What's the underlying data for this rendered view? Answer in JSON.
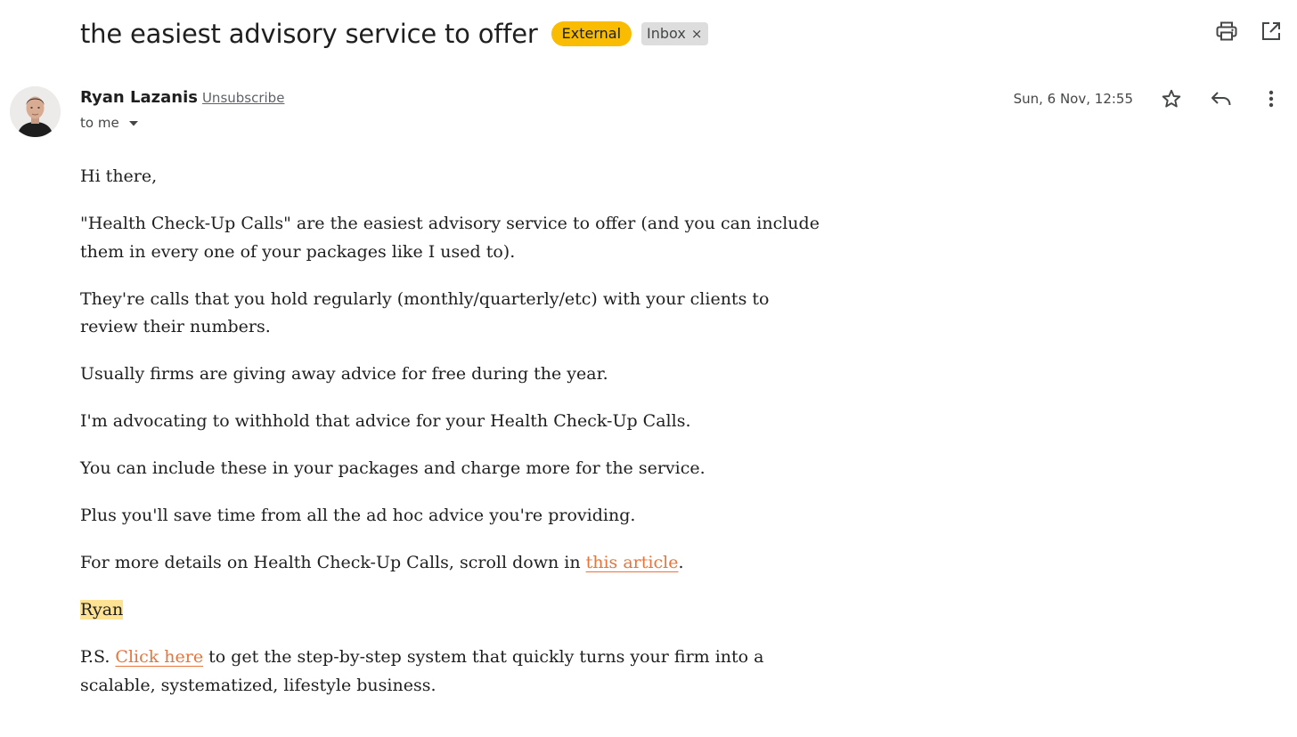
{
  "email": {
    "subject": "the easiest advisory service to offer",
    "labels": {
      "external": "External",
      "inbox": "Inbox",
      "remove_symbol": "×"
    },
    "sender": {
      "name": "Ryan Lazanis",
      "unsubscribe": "Unsubscribe",
      "recipient": "to me"
    },
    "date": "Sun, 6 Nov, 12:55",
    "body": {
      "p1": "Hi there,",
      "p2": "\"Health Check-Up Calls\" are the easiest advisory service to offer (and you can include them in every one of your packages like I used to).",
      "p3": "They're calls that you hold regularly (monthly/quarterly/etc) with your clients to review their numbers.",
      "p4": "Usually firms are giving away advice for free during the year.",
      "p5": "I'm advocating to withhold that advice for your Health Check-Up Calls.",
      "p6": "You can include these in your packages and charge more for the service.",
      "p7": "Plus you'll save time from all the ad hoc advice you're providing.",
      "p8_before": "For more details on Health Check-Up Calls, scroll down in ",
      "p8_link": "this article",
      "p8_after": ".",
      "signature": "Ryan",
      "ps_before": "P.S. ",
      "ps_link": "Click here",
      "ps_after": " to get the step-by-step system that quickly turns your firm into a scalable, systematized, lifestyle business."
    }
  },
  "icons": {
    "print": "print-icon",
    "open_new_window": "open-in-new-window-icon",
    "star": "star-icon",
    "reply": "reply-icon",
    "more": "more-vert-icon",
    "caret": "caret-down-icon"
  },
  "colors": {
    "external_label": "#f9bc00",
    "inbox_label": "#dddddd",
    "link": "#e8743b",
    "signature_highlight": "#fde293"
  }
}
